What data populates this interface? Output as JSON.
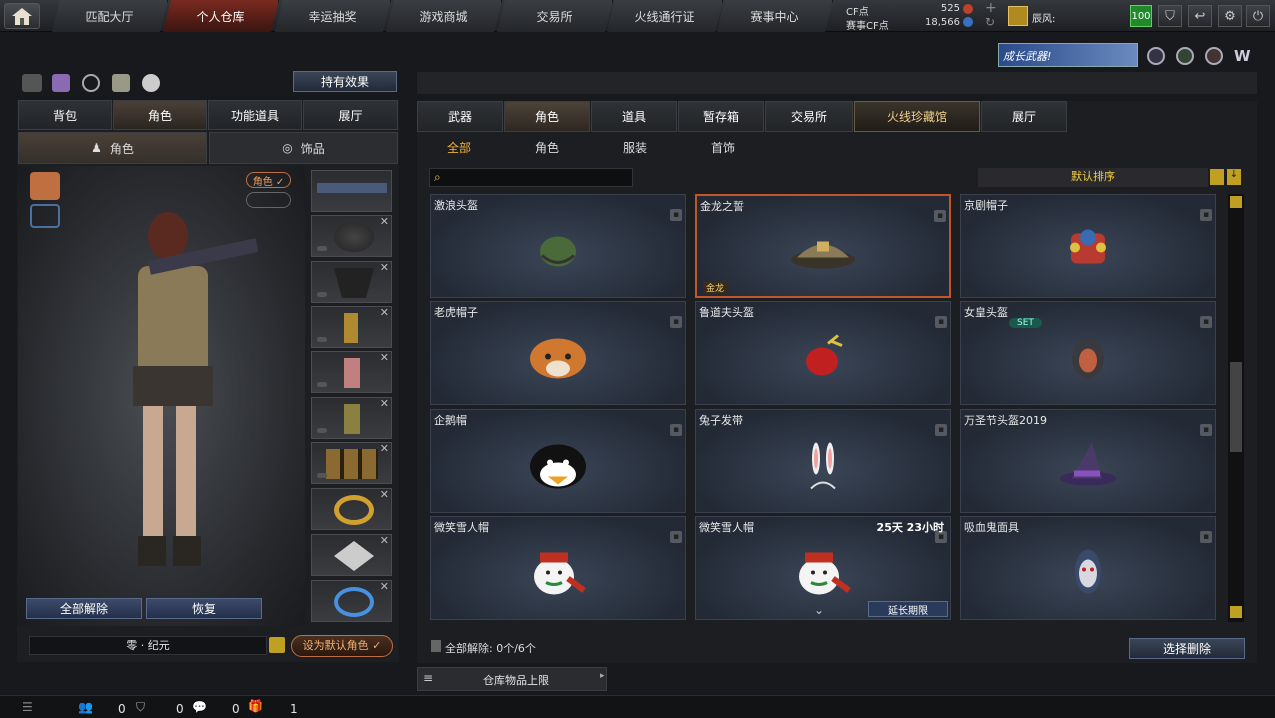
{
  "nav": {
    "tabs": [
      "匹配大厅",
      "个人仓库",
      "幸运抽奖",
      "游戏商城",
      "交易所",
      "火线通行证",
      "赛事中心"
    ]
  },
  "currency": {
    "cf_label": "CF点",
    "cf_value": "525",
    "event_label": "赛事CF点",
    "event_value": "18,566"
  },
  "user": {
    "rank_label": "辰风:",
    "level": "100"
  },
  "header": {
    "effect_button": "持有效果",
    "promo": "成长武器!"
  },
  "left": {
    "tabs": [
      "背包",
      "角色",
      "功能道具",
      "展厅"
    ],
    "subtabs": [
      "角色",
      "饰品"
    ],
    "toggle_char": "角色 ✓",
    "reset_all": "全部解除",
    "restore": "恢复",
    "char_name": "零 · 纪元",
    "set_default": "设为默认角色 ✓"
  },
  "right": {
    "tabs": [
      "武器",
      "角色",
      "道具",
      "暂存箱",
      "交易所",
      "火线珍藏馆",
      "展厅"
    ],
    "filters": [
      "全部",
      "角色",
      "服装",
      "首饰"
    ],
    "sort_label": "默认排序",
    "items": [
      {
        "name": "激浪头盔",
        "icon": "helmet-icon"
      },
      {
        "name": "金龙之誓",
        "icon": "dragon-cap-icon",
        "tag": "金龙"
      },
      {
        "name": "京剧帽子",
        "icon": "opera-hat-icon"
      },
      {
        "name": "老虎帽子",
        "icon": "tiger-hat-icon"
      },
      {
        "name": "鲁道夫头盔",
        "icon": "rudolph-helmet-icon"
      },
      {
        "name": "女皇头盔",
        "icon": "empress-helmet-icon",
        "badge": "SET"
      },
      {
        "name": "企鹅帽",
        "icon": "penguin-hat-icon"
      },
      {
        "name": "兔子发带",
        "icon": "bunny-band-icon"
      },
      {
        "name": "万圣节头盔2019",
        "icon": "witch-hat-icon"
      },
      {
        "name": "微笑雪人帽",
        "icon": "snowman-hat-icon"
      },
      {
        "name": "微笑雪人帽",
        "icon": "snowman-hat-icon",
        "timer": "25天 23小时",
        "action": "延长期限"
      },
      {
        "name": "吸血鬼面具",
        "icon": "vampire-mask-icon"
      }
    ],
    "release_info": "全部解除: 0个/6个",
    "select_delete": "选择删除",
    "storage_limit": "仓库物品上限"
  },
  "bottom": {
    "counters": [
      "0",
      "0",
      "0",
      "1"
    ]
  }
}
